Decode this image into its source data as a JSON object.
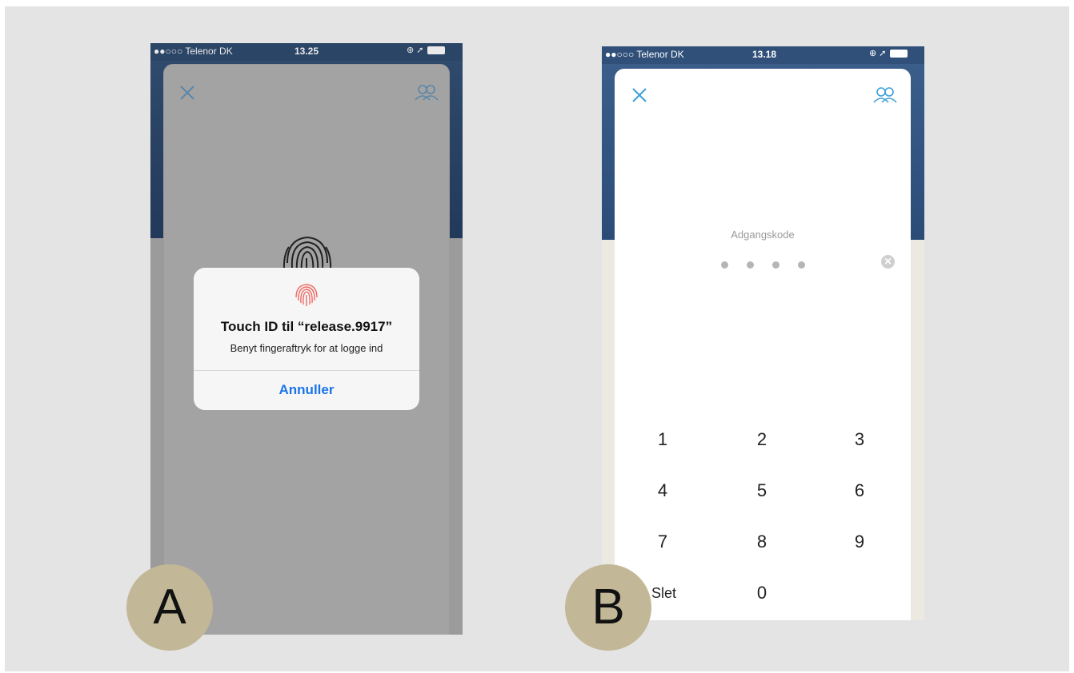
{
  "phone_a": {
    "status": {
      "carrier": "●●○○○ Telenor DK",
      "time": "13.25",
      "indicators": "⊕ ➚"
    },
    "close_icon": "close-icon",
    "accounts_icon": "people-icon",
    "fingerprint_icon": "fingerprint-icon",
    "dialog": {
      "title": "Touch ID til “release.9917”",
      "subtitle": "Benyt fingeraftryk for at logge ind",
      "cancel_label": "Annuller"
    },
    "badge": "A"
  },
  "phone_b": {
    "status": {
      "carrier": "●●○○○ Telenor DK",
      "time": "13.18",
      "indicators": "⊕ ➚"
    },
    "close_icon": "close-icon",
    "accounts_icon": "people-icon",
    "pin_label": "Adgangskode",
    "pin_digits_entered": 4,
    "clear_symbol": "✕",
    "keypad": {
      "k1": "1",
      "k2": "2",
      "k3": "3",
      "k4": "4",
      "k5": "5",
      "k6": "6",
      "k7": "7",
      "k8": "8",
      "k9": "9",
      "delete": "Slet",
      "k0": "0"
    },
    "badge": "B"
  },
  "colors": {
    "header_blue": "#2c4c78",
    "badge": "#c2b897",
    "link_blue": "#1a74e8",
    "icon_teal": "#3aa0d8"
  }
}
